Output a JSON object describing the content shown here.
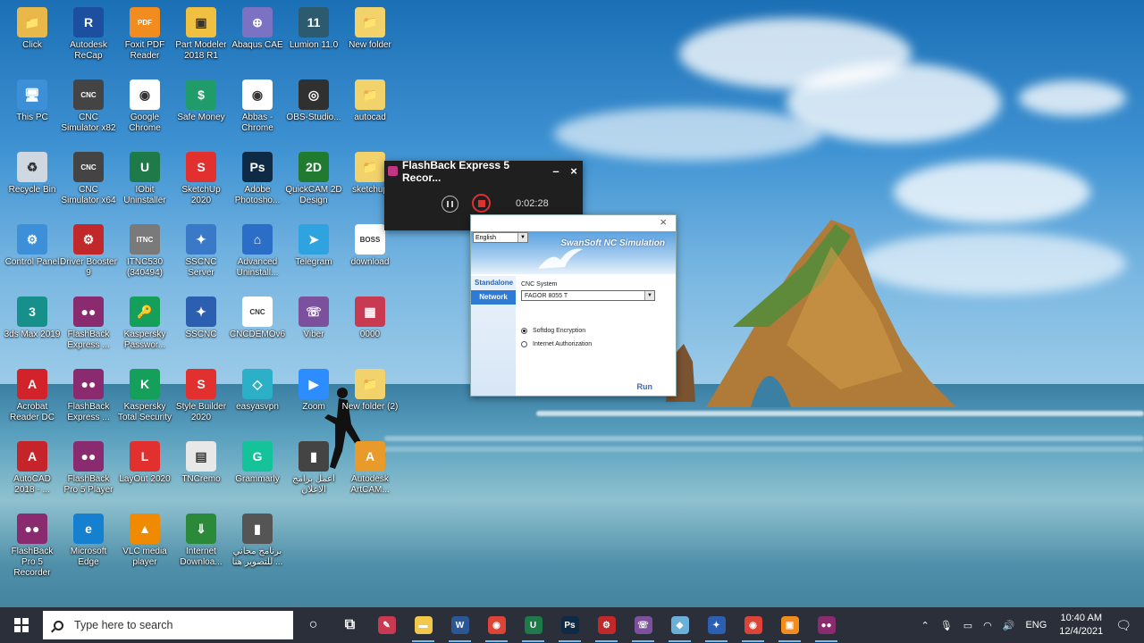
{
  "desktop_icons": [
    {
      "label": "Click",
      "color": "#e9b84a",
      "glyph": "📁"
    },
    {
      "label": "Autodesk ReCap",
      "color": "#1d4fa0",
      "glyph": "R"
    },
    {
      "label": "Foxit PDF Reader",
      "color": "#f28c1e",
      "glyph": "PDF"
    },
    {
      "label": "Part Modeler 2018 R1",
      "color": "#f0c040",
      "glyph": "▣"
    },
    {
      "label": "Abaqus CAE",
      "color": "#7c72c4",
      "glyph": "⊕"
    },
    {
      "label": "Lumion 11.0",
      "color": "#2c5a6e",
      "glyph": "11"
    },
    {
      "label": "New folder",
      "color": "#f2d26a",
      "glyph": "📁"
    },
    {
      "label": "This PC",
      "color": "#3d8fd8",
      "glyph": "🖥"
    },
    {
      "label": "CNC Simulator x82",
      "color": "#444444",
      "glyph": "CNC"
    },
    {
      "label": "Google Chrome",
      "color": "#ffffff",
      "glyph": "◉"
    },
    {
      "label": "Safe Money",
      "color": "#1f9c6a",
      "glyph": "$"
    },
    {
      "label": "Abbas - Chrome",
      "color": "#ffffff",
      "glyph": "◉"
    },
    {
      "label": "OBS-Studio...",
      "color": "#303030",
      "glyph": "◎"
    },
    {
      "label": "autocad",
      "color": "#f2d26a",
      "glyph": "📁"
    },
    {
      "label": "Recycle Bin",
      "color": "#cfd8e0",
      "glyph": "♻"
    },
    {
      "label": "CNC Simulator x64",
      "color": "#444444",
      "glyph": "CNC"
    },
    {
      "label": "IObit Uninstaller",
      "color": "#1f7a4a",
      "glyph": "U"
    },
    {
      "label": "SketchUp 2020",
      "color": "#e2302f",
      "glyph": "S"
    },
    {
      "label": "Adobe Photosho...",
      "color": "#0f2a45",
      "glyph": "Ps"
    },
    {
      "label": "QuickCAM 2D Design",
      "color": "#207a30",
      "glyph": "2D"
    },
    {
      "label": "sketchup",
      "color": "#f2d26a",
      "glyph": "📁"
    },
    {
      "label": "Control Panel",
      "color": "#3d8fd8",
      "glyph": "⚙"
    },
    {
      "label": "Driver Booster 9",
      "color": "#c0282a",
      "glyph": "⚙"
    },
    {
      "label": "ITNC530 (340494)",
      "color": "#7a7a7a",
      "glyph": "ITNC"
    },
    {
      "label": "SSCNC Server",
      "color": "#3a78c8",
      "glyph": "✦"
    },
    {
      "label": "Advanced Uninstall...",
      "color": "#2b6ec8",
      "glyph": "⌂"
    },
    {
      "label": "Telegram",
      "color": "#2fa3e0",
      "glyph": "➤"
    },
    {
      "label": "download",
      "color": "#ffffff",
      "glyph": "BOSS"
    },
    {
      "label": "3ds Max 2019",
      "color": "#178f8a",
      "glyph": "3"
    },
    {
      "label": "FlashBack Express ...",
      "color": "#8a2a6f",
      "glyph": "●●"
    },
    {
      "label": "Kaspersky Passwor...",
      "color": "#14a05a",
      "glyph": "🔑"
    },
    {
      "label": "SSCNC",
      "color": "#2c5fb0",
      "glyph": "✦"
    },
    {
      "label": "CNCDEMOv6",
      "color": "#ffffff",
      "glyph": "CNC"
    },
    {
      "label": "Viber",
      "color": "#7b519d",
      "glyph": "☏"
    },
    {
      "label": "0000",
      "color": "#c83a52",
      "glyph": "▦"
    },
    {
      "label": "Acrobat Reader DC",
      "color": "#d2232a",
      "glyph": "A"
    },
    {
      "label": "FlashBack Express ...",
      "color": "#8a2a6f",
      "glyph": "●●"
    },
    {
      "label": "Kaspersky Total Security",
      "color": "#14a05a",
      "glyph": "K"
    },
    {
      "label": "Style Builder 2020",
      "color": "#e2302f",
      "glyph": "S"
    },
    {
      "label": "easyasvpn",
      "color": "#2bb0c8",
      "glyph": "◇"
    },
    {
      "label": "Zoom",
      "color": "#2d8cff",
      "glyph": "▶"
    },
    {
      "label": "New folder (2)",
      "color": "#f2d26a",
      "glyph": "📁"
    },
    {
      "label": "AutoCAD 2018 - ...",
      "color": "#c4242a",
      "glyph": "A"
    },
    {
      "label": "FlashBack Pro 5 Player",
      "color": "#8a2a6f",
      "glyph": "●●"
    },
    {
      "label": "LayOut 2020",
      "color": "#e2302f",
      "glyph": "L"
    },
    {
      "label": "TNCremo",
      "color": "#e8e8e8",
      "glyph": "▤"
    },
    {
      "label": "Grammarly",
      "color": "#15c39a",
      "glyph": "G"
    },
    {
      "label": "اعمل برامج الاعلان",
      "color": "#444444",
      "glyph": "▮"
    },
    {
      "label": "Autodesk ArtCAM...",
      "color": "#e89a2a",
      "glyph": "A"
    },
    {
      "label": "FlashBack Pro 5 Recorder",
      "color": "#8a2a6f",
      "glyph": "●●"
    },
    {
      "label": "Microsoft Edge",
      "color": "#1680d0",
      "glyph": "e"
    },
    {
      "label": "VLC media player",
      "color": "#f08a00",
      "glyph": "▲"
    },
    {
      "label": "Internet Downloa...",
      "color": "#2a8a3a",
      "glyph": "⇓"
    },
    {
      "label": "برنامج مجاني للتصوير هنا ...",
      "color": "#555555",
      "glyph": "▮"
    }
  ],
  "flashback": {
    "title": "FlashBack Express 5 Recor...",
    "minimize": "–",
    "close": "×",
    "timer": "0:02:28"
  },
  "swansoft": {
    "language": "English",
    "brand": "SwanSoft NC Simulation",
    "tabs": [
      "Standalone",
      "Network"
    ],
    "cnc_label": "CNC System",
    "cnc_value": "FAGOR 8055 T",
    "options": [
      "Softdog Encryption",
      "Internet Authorization"
    ],
    "run": "Run",
    "close": "×"
  },
  "taskbar": {
    "search_placeholder": "Type here to search",
    "apps": [
      {
        "name": "cortana",
        "glyph": "○",
        "color": "transparent"
      },
      {
        "name": "task-view",
        "glyph": "⧉",
        "color": "transparent"
      },
      {
        "name": "pen",
        "glyph": "✎",
        "color": "#c83a52"
      },
      {
        "name": "file-explorer",
        "glyph": "▬",
        "color": "#f2c84a"
      },
      {
        "name": "word",
        "glyph": "W",
        "color": "#2b5797"
      },
      {
        "name": "chrome",
        "glyph": "◉",
        "color": "#db4437"
      },
      {
        "name": "iobit",
        "glyph": "U",
        "color": "#1f7a4a"
      },
      {
        "name": "photoshop",
        "glyph": "Ps",
        "color": "#0f2a45"
      },
      {
        "name": "driver-booster",
        "glyph": "⚙",
        "color": "#c0282a"
      },
      {
        "name": "viber",
        "glyph": "☏",
        "color": "#7b519d"
      },
      {
        "name": "app-blue",
        "glyph": "◆",
        "color": "#6ab0d8"
      },
      {
        "name": "sscnc",
        "glyph": "✦",
        "color": "#2c5fb0"
      },
      {
        "name": "chrome-2",
        "glyph": "◉",
        "color": "#db4437"
      },
      {
        "name": "app-orange",
        "glyph": "▣",
        "color": "#f28c1e"
      },
      {
        "name": "flashback",
        "glyph": "●●",
        "color": "#8a2a6f"
      }
    ],
    "lang": "ENG",
    "time": "10:40 AM",
    "date": "12/4/2021"
  }
}
